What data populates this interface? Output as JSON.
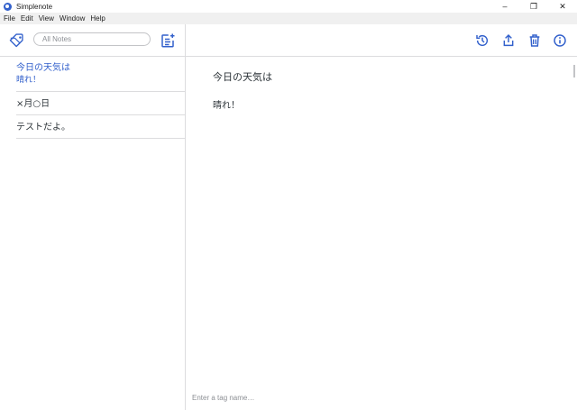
{
  "window": {
    "title": "Simplenote",
    "controls": [
      "–",
      "❐",
      "✕"
    ]
  },
  "menu": [
    "File",
    "Edit",
    "View",
    "Window",
    "Help"
  ],
  "sidebar": {
    "search_placeholder": "All Notes",
    "notes": [
      {
        "title": "今日の天気は",
        "preview": "晴れ！",
        "selected": true
      },
      {
        "title": "×月○日",
        "preview": "",
        "selected": false
      },
      {
        "title": "テストだよ。",
        "preview": "",
        "selected": false
      }
    ]
  },
  "editor": {
    "title": "今日の天気は",
    "body": "晴れ！",
    "tag_placeholder": "Enter a tag name…"
  },
  "colors": {
    "accent": "#3361cc",
    "text": "#2c3338",
    "border": "#dcdcde"
  },
  "icons": [
    "tag-icon",
    "new-note-icon",
    "history-icon",
    "share-icon",
    "trash-icon",
    "info-icon"
  ]
}
